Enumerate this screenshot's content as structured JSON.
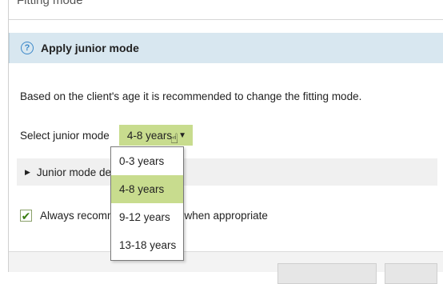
{
  "previous_section_title": "Fitting mode",
  "panel": {
    "title": "Apply junior mode",
    "help_icon": "help-circle-icon",
    "description": "Based on the client's age it is recommended to change the fitting mode."
  },
  "junior_mode_select": {
    "label": "Select junior mode",
    "selected_value": "4-8 years",
    "arrow_icon": "triangle-down-icon",
    "options": [
      {
        "label": "0-3 years",
        "selected": false
      },
      {
        "label": "4-8 years",
        "selected": true
      },
      {
        "label": "9-12 years",
        "selected": false
      },
      {
        "label": "13-18 years",
        "selected": false
      }
    ]
  },
  "expander": {
    "label_visible": "Junior mode det",
    "caret_icon": "triangle-right-icon"
  },
  "recommend_checkbox": {
    "checked": true,
    "label_left": "Always recomm",
    "label_right": "e when appropriate"
  },
  "colors": {
    "header_bg": "#d8e7f0",
    "accent_green": "#c8dc8e",
    "help_blue": "#3a87c8",
    "check_green": "#3a7d12"
  }
}
